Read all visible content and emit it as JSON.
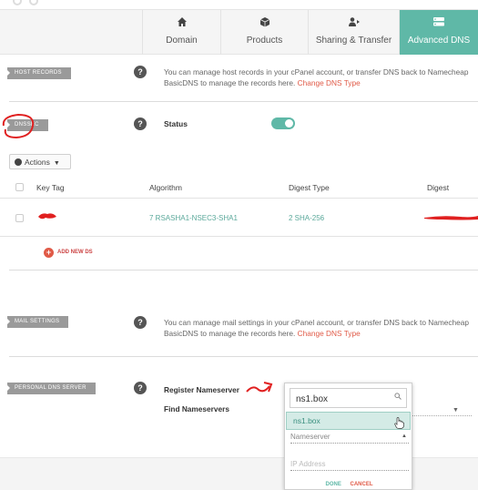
{
  "tabs": [
    {
      "label": "Domain",
      "icon": "home-icon"
    },
    {
      "label": "Products",
      "icon": "box-icon"
    },
    {
      "label": "Sharing & Transfer",
      "icon": "users-icon"
    },
    {
      "label": "Advanced DNS",
      "icon": "server-icon",
      "active": true
    }
  ],
  "host_records": {
    "label": "HOST RECORDS",
    "desc_line1": "You can manage host records in your cPanel account, or transfer DNS back to Namecheap",
    "desc_line2_prefix": "BasicDNS to manage the records here. ",
    "desc_link": "Change DNS Type"
  },
  "dnssec": {
    "label": "DNSSEC",
    "status_label": "Status",
    "status_on": true,
    "actions_label": "Actions",
    "columns": [
      "Key Tag",
      "Algorithm",
      "Digest Type",
      "Digest"
    ],
    "rows": [
      {
        "key_tag": "",
        "algorithm": "7 RSASHA1-NSEC3-SHA1",
        "digest_type": "2 SHA-256",
        "digest": ""
      }
    ],
    "add_label": "ADD NEW DS"
  },
  "mail_settings": {
    "label": "MAIL SETTINGS",
    "desc_line1": "You can manage mail settings in your cPanel account, or transfer DNS back to Namecheap",
    "desc_line2_prefix": "BasicDNS to manage the records here. ",
    "desc_link": "Change DNS Type"
  },
  "personal_dns": {
    "label": "PERSONAL DNS SERVER",
    "register_label": "Register Nameserver",
    "find_label": "Find Nameservers"
  },
  "popup": {
    "search_value": "ns1.box",
    "option": "ns1.box",
    "nameserver_placeholder": "Nameserver",
    "ip_placeholder": "IP Address",
    "done": "DONE",
    "cancel": "CANCEL"
  },
  "colors": {
    "accent": "#5fb8a7",
    "link": "#e05a47",
    "annotation": "#e02020"
  }
}
